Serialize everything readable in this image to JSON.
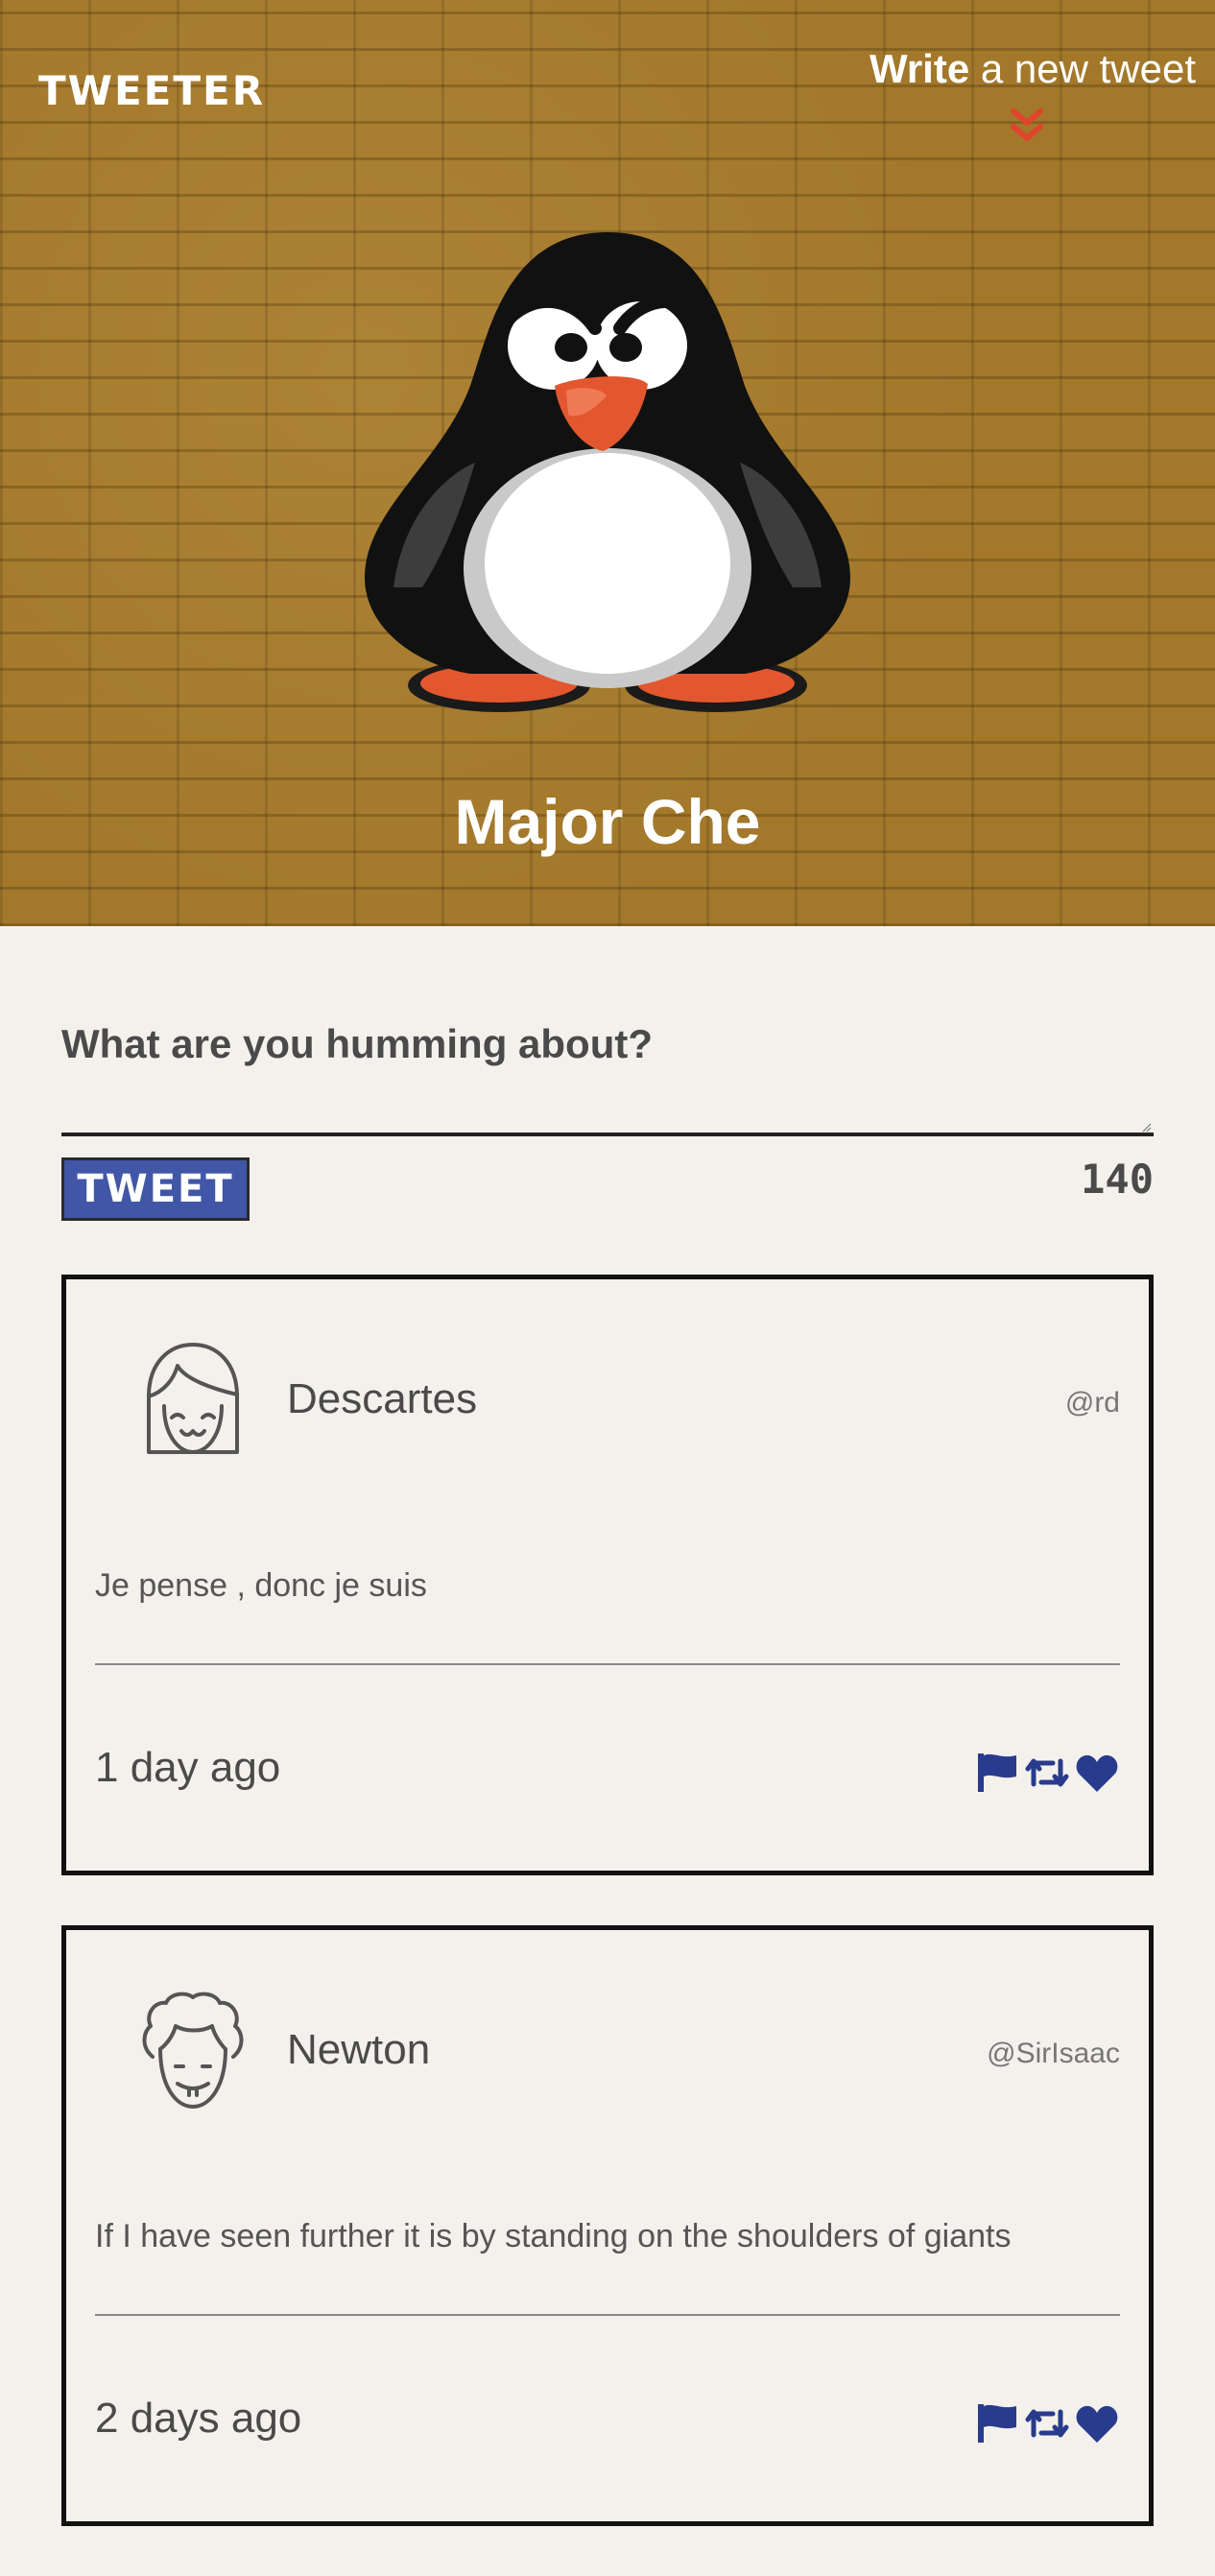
{
  "app": {
    "logo": "TWEETER"
  },
  "nav": {
    "compose_strong": "Write",
    "compose_rest": " a new tweet",
    "compose_icon": "double-chevron-down-icon"
  },
  "profile": {
    "name": "Major Che",
    "avatar_icon": "penguin-avatar"
  },
  "composer": {
    "label": "What are you humming about?",
    "value": "",
    "placeholder": "",
    "button_label": "TWEET",
    "char_count": "140"
  },
  "colors": {
    "header_bg": "#a3782b",
    "page_bg": "#f4f1ed",
    "button_bg": "#4156a6",
    "action_icons": "#283b8c",
    "compose_arrow": "#e0442a"
  },
  "tweets": [
    {
      "name": "Descartes",
      "handle": "@rd",
      "text": "Je pense , donc je suis",
      "time": "1 day ago",
      "avatar_icon": "girl-face-avatar",
      "actions": [
        "flag-icon",
        "retweet-icon",
        "heart-icon"
      ]
    },
    {
      "name": "Newton",
      "handle": "@SirIsaac",
      "text": "If I have seen further it is by standing on the shoulders of giants",
      "time": "2 days ago",
      "avatar_icon": "curly-hair-face-avatar",
      "actions": [
        "flag-icon",
        "retweet-icon",
        "heart-icon"
      ]
    }
  ]
}
